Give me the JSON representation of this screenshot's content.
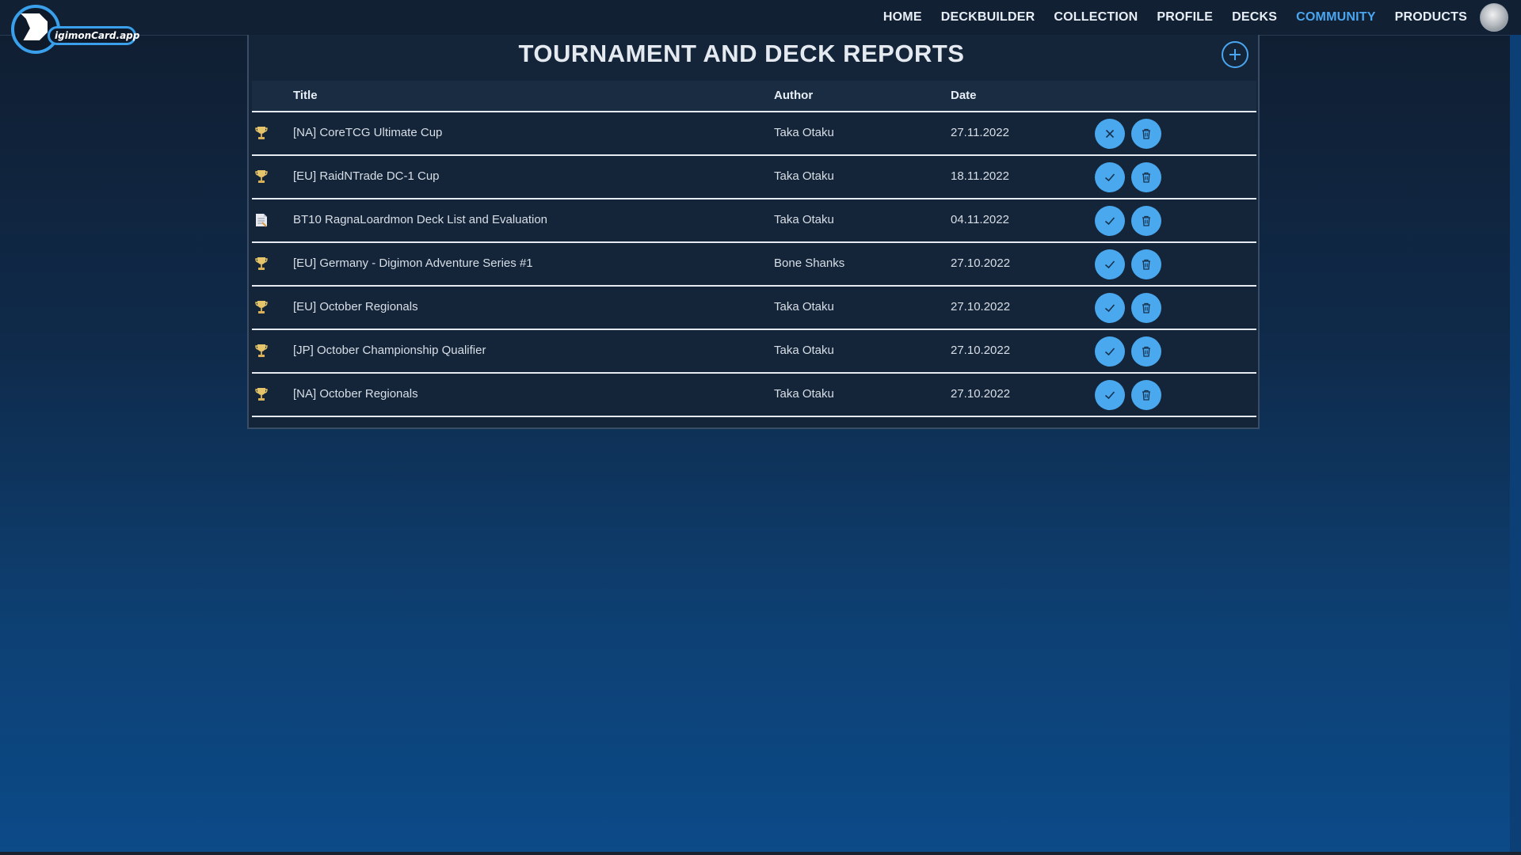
{
  "logo": {
    "text": "igimonCard.app"
  },
  "nav": {
    "items": [
      {
        "label": "HOME"
      },
      {
        "label": "DECKBUILDER"
      },
      {
        "label": "COLLECTION"
      },
      {
        "label": "PROFILE"
      },
      {
        "label": "DECKS"
      },
      {
        "label": "COMMUNITY",
        "active": true
      },
      {
        "label": "PRODUCTS"
      }
    ]
  },
  "colors": {
    "accent": "#4aa6f0",
    "button": "#4aa8ee",
    "panel": "#14253a"
  },
  "reports": {
    "title": "TOURNAMENT AND DECK REPORTS",
    "columns": {
      "title": "Title",
      "author": "Author",
      "date": "Date"
    },
    "rows": [
      {
        "icon": "trophy-icon",
        "title": "[NA] CoreTCG Ultimate Cup",
        "author": "Taka Otaku",
        "date": "27.11.2022",
        "status": "x-icon"
      },
      {
        "icon": "trophy-icon",
        "title": "[EU] RaidNTrade DC-1 Cup",
        "author": "Taka Otaku",
        "date": "18.11.2022",
        "status": "check-icon"
      },
      {
        "icon": "document-icon",
        "title": "BT10 RagnaLoardmon Deck List and Evaluation",
        "author": "Taka Otaku",
        "date": "04.11.2022",
        "status": "check-icon"
      },
      {
        "icon": "trophy-icon",
        "title": "[EU] Germany - Digimon Adventure Series #1",
        "author": "Bone Shanks",
        "date": "27.10.2022",
        "status": "check-icon"
      },
      {
        "icon": "trophy-icon",
        "title": "[EU] October Regionals",
        "author": "Taka Otaku",
        "date": "27.10.2022",
        "status": "check-icon"
      },
      {
        "icon": "trophy-icon",
        "title": "[JP] October Championship Qualifier",
        "author": "Taka Otaku",
        "date": "27.10.2022",
        "status": "check-icon"
      },
      {
        "icon": "trophy-icon",
        "title": "[NA] October Regionals",
        "author": "Taka Otaku",
        "date": "27.10.2022",
        "status": "check-icon"
      }
    ]
  }
}
